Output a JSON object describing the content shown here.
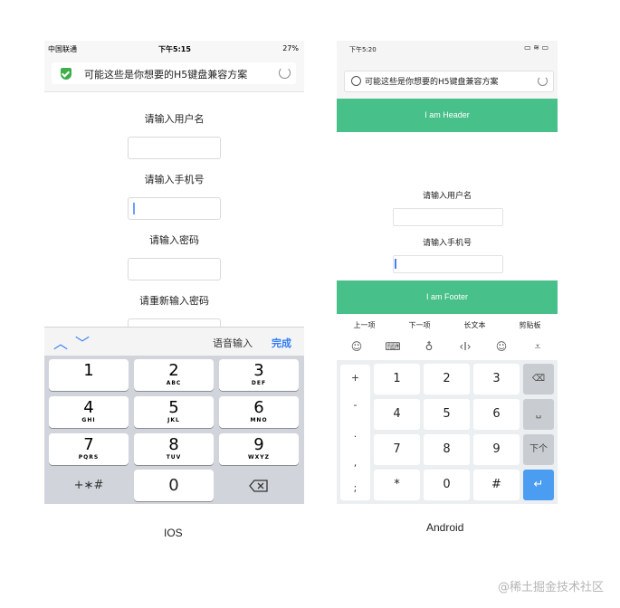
{
  "ios": {
    "status": {
      "carrier": "中国联通",
      "time": "下午5:15",
      "battery": "27%"
    },
    "url_title": "可能这些是你想要的H5键盘兼容方案",
    "fields": [
      {
        "label": "请输入用户名"
      },
      {
        "label": "请输入手机号"
      },
      {
        "label": "请输入密码"
      },
      {
        "label": "请重新输入密码"
      }
    ],
    "toolbar": {
      "voice": "语音输入",
      "done": "完成"
    },
    "keys": [
      {
        "n": "1",
        "l": ""
      },
      {
        "n": "2",
        "l": "ABC"
      },
      {
        "n": "3",
        "l": "DEF"
      },
      {
        "n": "4",
        "l": "GHI"
      },
      {
        "n": "5",
        "l": "JKL"
      },
      {
        "n": "6",
        "l": "MNO"
      },
      {
        "n": "7",
        "l": "PQRS"
      },
      {
        "n": "8",
        "l": "TUV"
      },
      {
        "n": "9",
        "l": "WXYZ"
      }
    ],
    "sym_key": "+∗#",
    "zero_key": "0",
    "caption": "IOS"
  },
  "android": {
    "status": {
      "time": "下午5:20"
    },
    "url_title": "可能这些是你想要的H5键盘兼容方案",
    "header": "I am Header",
    "footer": "I am Footer",
    "fields": [
      {
        "label": "请输入用户名"
      },
      {
        "label": "请输入手机号"
      }
    ],
    "toolbar": [
      "上一项",
      "下一项",
      "长文本",
      "剪贴板"
    ],
    "symbols": [
      "+",
      "-",
      ".",
      ",",
      ";"
    ],
    "keys": [
      "1",
      "2",
      "3",
      "4",
      "5",
      "6",
      "7",
      "8",
      "9",
      "*",
      "0",
      "#"
    ],
    "side_keys": {
      "delete": "⌫",
      "space": "␣",
      "next": "下个",
      "enter": "↵"
    },
    "caption": "Android"
  },
  "watermark": "@稀土掘金技术社区"
}
